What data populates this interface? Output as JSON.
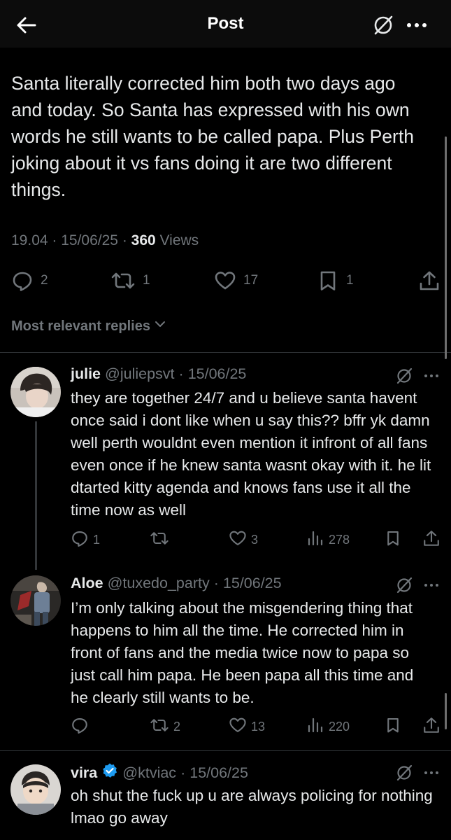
{
  "header": {
    "title": "Post"
  },
  "post": {
    "text": "Santa literally corrected him both two days ago and today. So Santa has expressed with his own words he still wants to be called papa. Plus Perth joking about it vs fans doing it are two different things.",
    "time": "19.04",
    "date": "15/06/25",
    "views_count": "360",
    "views_label": "Views",
    "replies": "2",
    "reposts": "1",
    "likes": "17",
    "bookmarks": "1"
  },
  "replies_filter": {
    "label": "Most relevant replies"
  },
  "replies": [
    {
      "name": "julie",
      "handle": "@juliepsvt",
      "date": "15/06/25",
      "text": "they are together 24/7 and u believe santa havent once said i dont like when u say this?? bffr yk damn well perth wouldnt even mention it infront of all fans even once if he knew santa wasnt okay with it. he lit dtarted kitty agenda and knows fans use it all the time now as well",
      "replies": "1",
      "reposts": "",
      "likes": "3",
      "views": "278"
    },
    {
      "name": "Aloe",
      "handle": "@tuxedo_party",
      "date": "15/06/25",
      "text": "I’m only talking about the misgendering thing that happens to him all the time. He corrected him in front of fans and the media twice now to papa so just call him papa. He been papa all this time and he clearly still wants to be.",
      "replies": "",
      "reposts": "2",
      "likes": "13",
      "views": "220"
    },
    {
      "name": "vira",
      "handle": "@ktviac",
      "date": "15/06/25",
      "text": "oh shut the fuck up u are always policing for nothing lmao go away",
      "verified": true
    }
  ],
  "colors": {
    "background": "#000000",
    "text": "#e7e9ea",
    "muted": "#71767b",
    "verified": "#1d9bf0",
    "divider": "#2f3336"
  },
  "icons": [
    "back-arrow-icon",
    "grok-icon",
    "more-icon",
    "reply-icon",
    "repost-icon",
    "like-icon",
    "bookmark-icon",
    "share-icon",
    "views-icon",
    "verified-icon",
    "chevron-down-icon"
  ]
}
